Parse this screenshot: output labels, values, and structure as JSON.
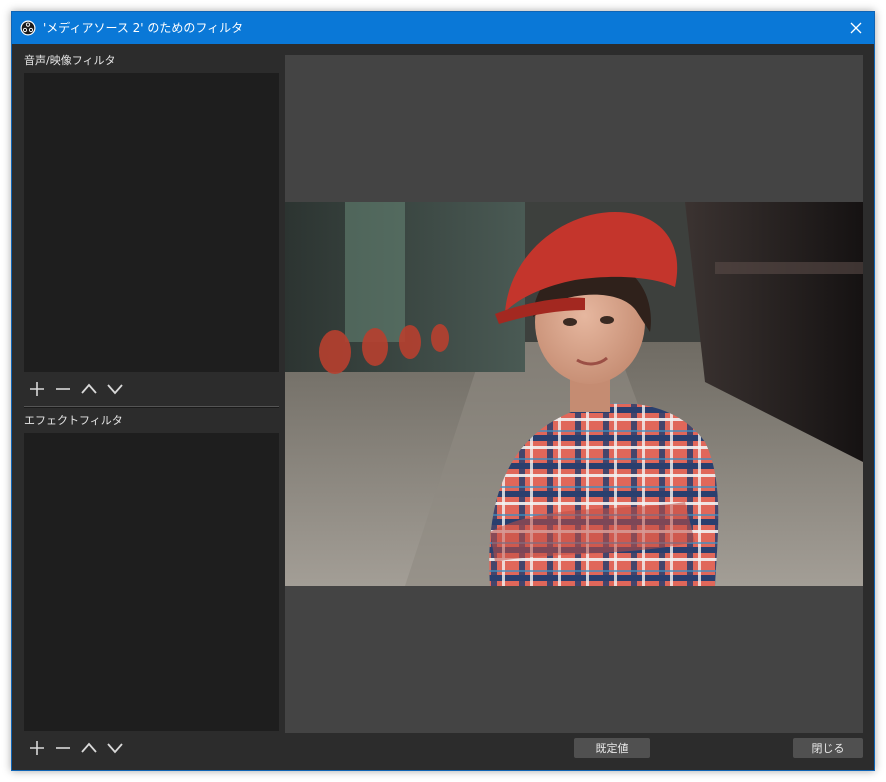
{
  "window": {
    "title": "'メディアソース 2' のためのフィルタ"
  },
  "panels": {
    "audio_video_filters_label": "音声/映像フィルタ",
    "effect_filters_label": "エフェクトフィルタ"
  },
  "toolbar_icons": [
    "plus-icon",
    "minus-icon",
    "chevron-up-icon",
    "chevron-down-icon"
  ],
  "buttons": {
    "defaults_label": "既定値",
    "close_label": "閉じる"
  },
  "colors": {
    "titlebar": "#0a78d7",
    "window_bg": "#2c2c2c",
    "list_bg": "#1e1e1e",
    "preview_bg": "#444444",
    "button_bg": "#505050"
  }
}
